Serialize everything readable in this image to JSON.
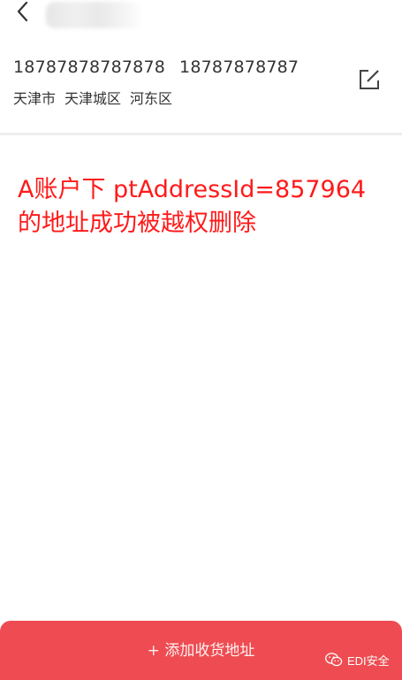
{
  "header": {
    "back_icon": "chevron-left-icon"
  },
  "address": {
    "phone_primary": "18787878787878",
    "phone_secondary": "18787878787",
    "province": "天津市",
    "city": "天津城区",
    "district": "河东区",
    "edit_icon": "edit-icon"
  },
  "annotation": {
    "line1": "A账户下  ptAddressId=857964",
    "line2": "的地址成功被越权删除"
  },
  "footer": {
    "add_label": "+ 添加收货地址"
  },
  "watermark": {
    "text": "EDI安全",
    "icon": "wechat-icon"
  },
  "colors": {
    "accent": "#ee4c52",
    "annotation": "#ff1a1a",
    "text": "#333333",
    "divider": "#eeeeee"
  }
}
